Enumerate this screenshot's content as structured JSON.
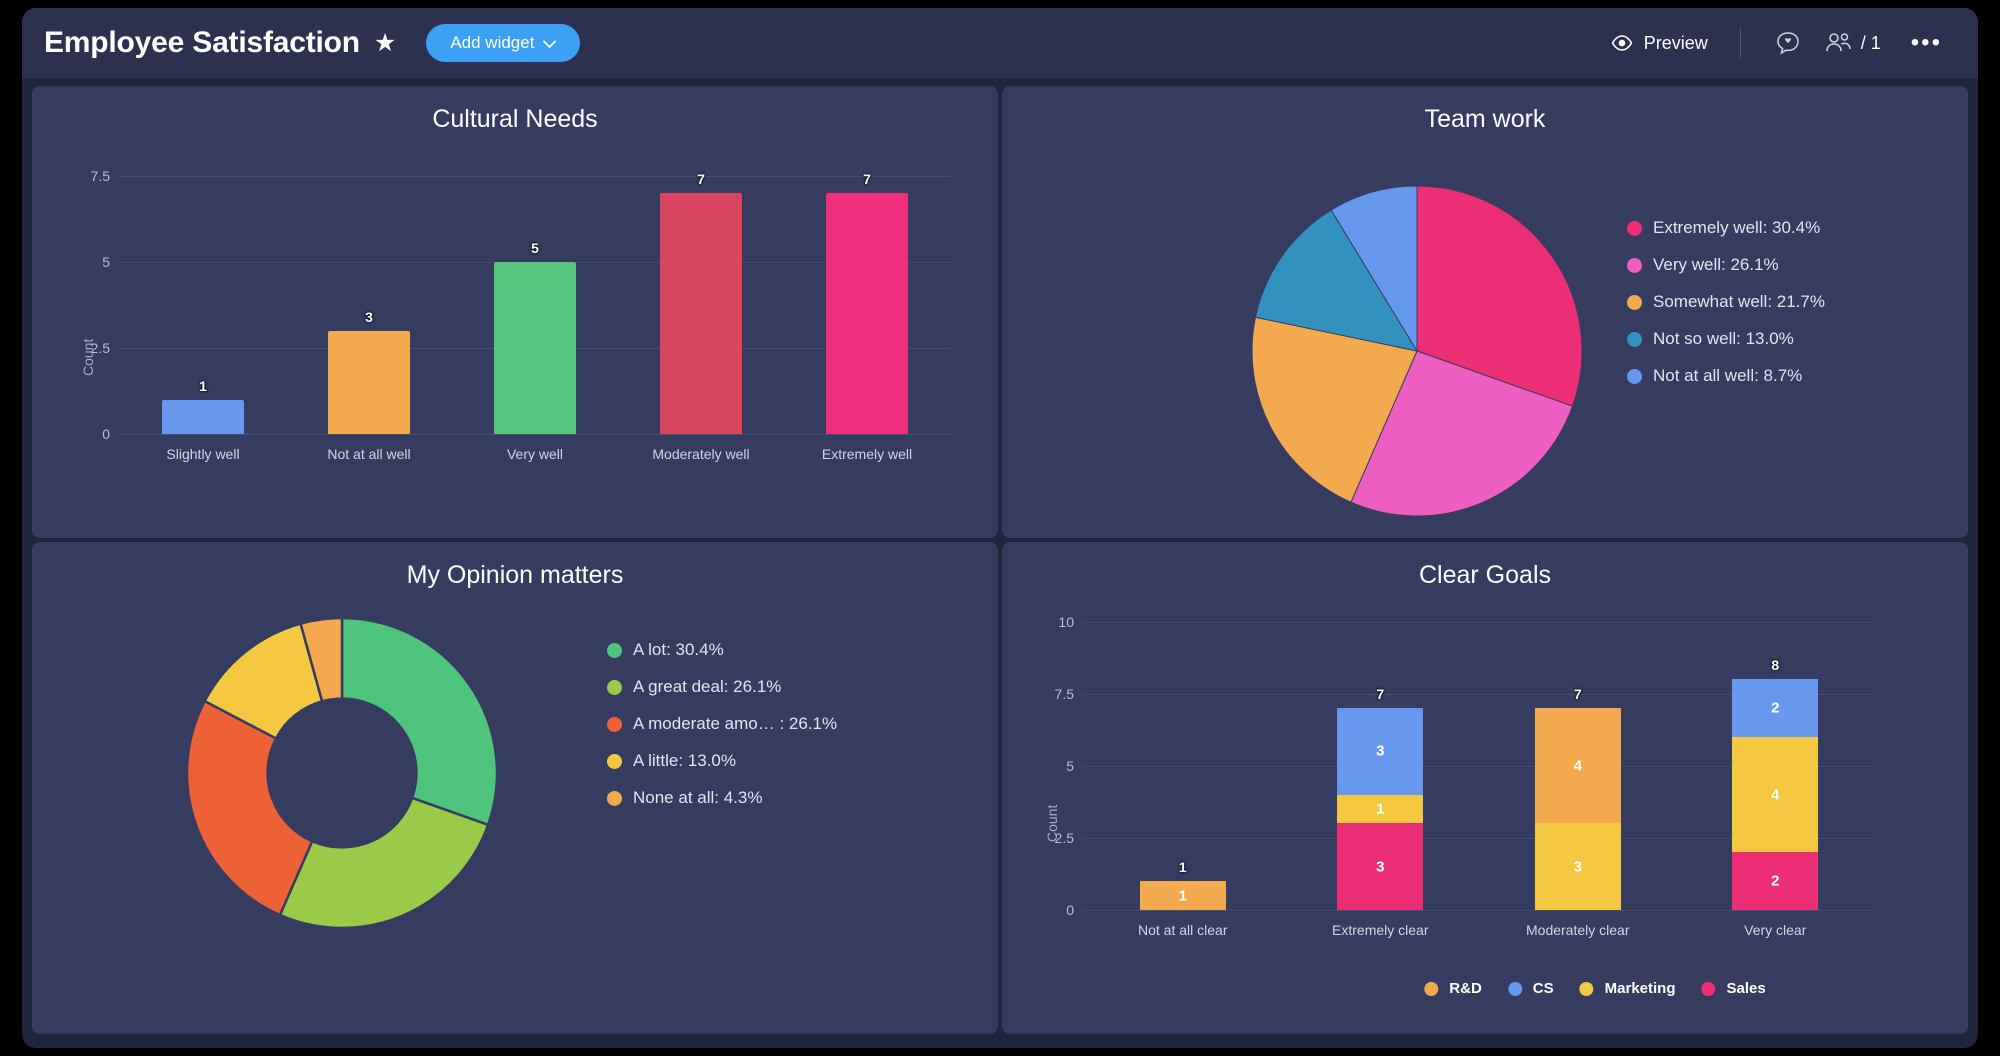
{
  "header": {
    "title": "Employee Satisfaction",
    "star_icon": "star-icon",
    "add_widget_label": "Add widget",
    "chevron": "⌄",
    "preview_label": "Preview",
    "eye_icon": "eye-icon",
    "comment_icon": "comment-icon",
    "people_icon": "people-icon",
    "people_count": "/ 1",
    "more_icon": "•••"
  },
  "palette": {
    "page_bg": "#20243d",
    "header_bg": "#2b314f",
    "widget_bg": "#353c60",
    "accent_blue": "#3ca0f4",
    "gridline": "#454c70"
  },
  "widgets": [
    {
      "id": "cultural-needs",
      "title": "Cultural Needs"
    },
    {
      "id": "team-work",
      "title": "Team work"
    },
    {
      "id": "my-opinion-matters",
      "title": "My Opinion matters"
    },
    {
      "id": "clear-goals",
      "title": "Clear Goals"
    }
  ],
  "chart_data": [
    {
      "id": "cultural-needs",
      "type": "bar",
      "title": "Cultural Needs",
      "xlabel": "",
      "ylabel": "Count",
      "ylim": [
        0,
        8.125
      ],
      "yticks": [
        "0",
        "2.5",
        "5",
        "7.5"
      ],
      "ytick_values": [
        0,
        2.5,
        5,
        7.5
      ],
      "grid": true,
      "categories": [
        "Slightly well",
        "Not at all well",
        "Very well",
        "Moderately well",
        "Extremely well"
      ],
      "values": [
        1,
        3,
        5,
        7,
        7
      ],
      "colors": [
        "#6699ee",
        "#f3aa4e",
        "#56c47d",
        "#d9455f",
        "#ef2e7d"
      ]
    },
    {
      "id": "team-work",
      "type": "pie",
      "title": "Team work",
      "legend_position": "right",
      "labels": [
        "Extremely well",
        "Very well",
        "Somewhat well",
        "Not so well",
        "Not at all well"
      ],
      "values": [
        30.4,
        26.1,
        21.7,
        13.0,
        8.7
      ],
      "legend_entries": [
        "Extremely well: 30.4%",
        "Very well: 26.1%",
        "Somewhat well: 21.7%",
        "Not so well: 13.0%",
        "Not at all well: 8.7%"
      ],
      "colors": [
        "#ec2e77",
        "#ef5fc2",
        "#f3aa4e",
        "#3392bd",
        "#6699ee"
      ]
    },
    {
      "id": "my-opinion-matters",
      "type": "pie",
      "donut": true,
      "title": "My Opinion matters",
      "legend_position": "right",
      "labels": [
        "A lot",
        "A great deal",
        "A moderate amo… ",
        "A little",
        "None at all"
      ],
      "values": [
        30.4,
        26.1,
        26.1,
        13.0,
        4.3
      ],
      "legend_entries": [
        "A lot: 30.4%",
        "A great deal: 26.1%",
        "A moderate amo…  : 26.1%",
        "A little: 13.0%",
        "None at all: 4.3%"
      ],
      "colors": [
        "#4fc47d",
        "#9acb48",
        "#ec6236",
        "#f5c842",
        "#f3aa4e"
      ]
    },
    {
      "id": "clear-goals",
      "type": "bar",
      "stacked": true,
      "title": "Clear Goals",
      "xlabel": "",
      "ylabel": "Count",
      "ylim": [
        0,
        10.4
      ],
      "yticks": [
        "0",
        "2.5",
        "5",
        "7.5",
        "10"
      ],
      "ytick_values": [
        0,
        2.5,
        5,
        7.5,
        10
      ],
      "grid": true,
      "categories": [
        "Not at all clear",
        "Extremely clear",
        "Moderately clear",
        "Very clear"
      ],
      "totals": [
        1,
        7,
        7,
        8
      ],
      "series": [
        {
          "name": "Sales",
          "color": "#ec2e77",
          "values": [
            0,
            3,
            0,
            2
          ]
        },
        {
          "name": "Marketing",
          "color": "#f5c842",
          "values": [
            0,
            1,
            3,
            4
          ]
        },
        {
          "name": "CS",
          "color": "#6699ee",
          "values": [
            0,
            3,
            0,
            2
          ]
        },
        {
          "name": "R&D",
          "color": "#f3aa4e",
          "values": [
            1,
            0,
            4,
            0
          ]
        }
      ],
      "stack_order": [
        "Sales",
        "Marketing",
        "CS",
        "R&D"
      ],
      "legend_entries": [
        "R&D",
        "CS",
        "Marketing",
        "Sales"
      ],
      "legend_colors": [
        "#f3aa4e",
        "#6699ee",
        "#f5c842",
        "#ec2e77"
      ],
      "legend_position": "bottom"
    }
  ]
}
